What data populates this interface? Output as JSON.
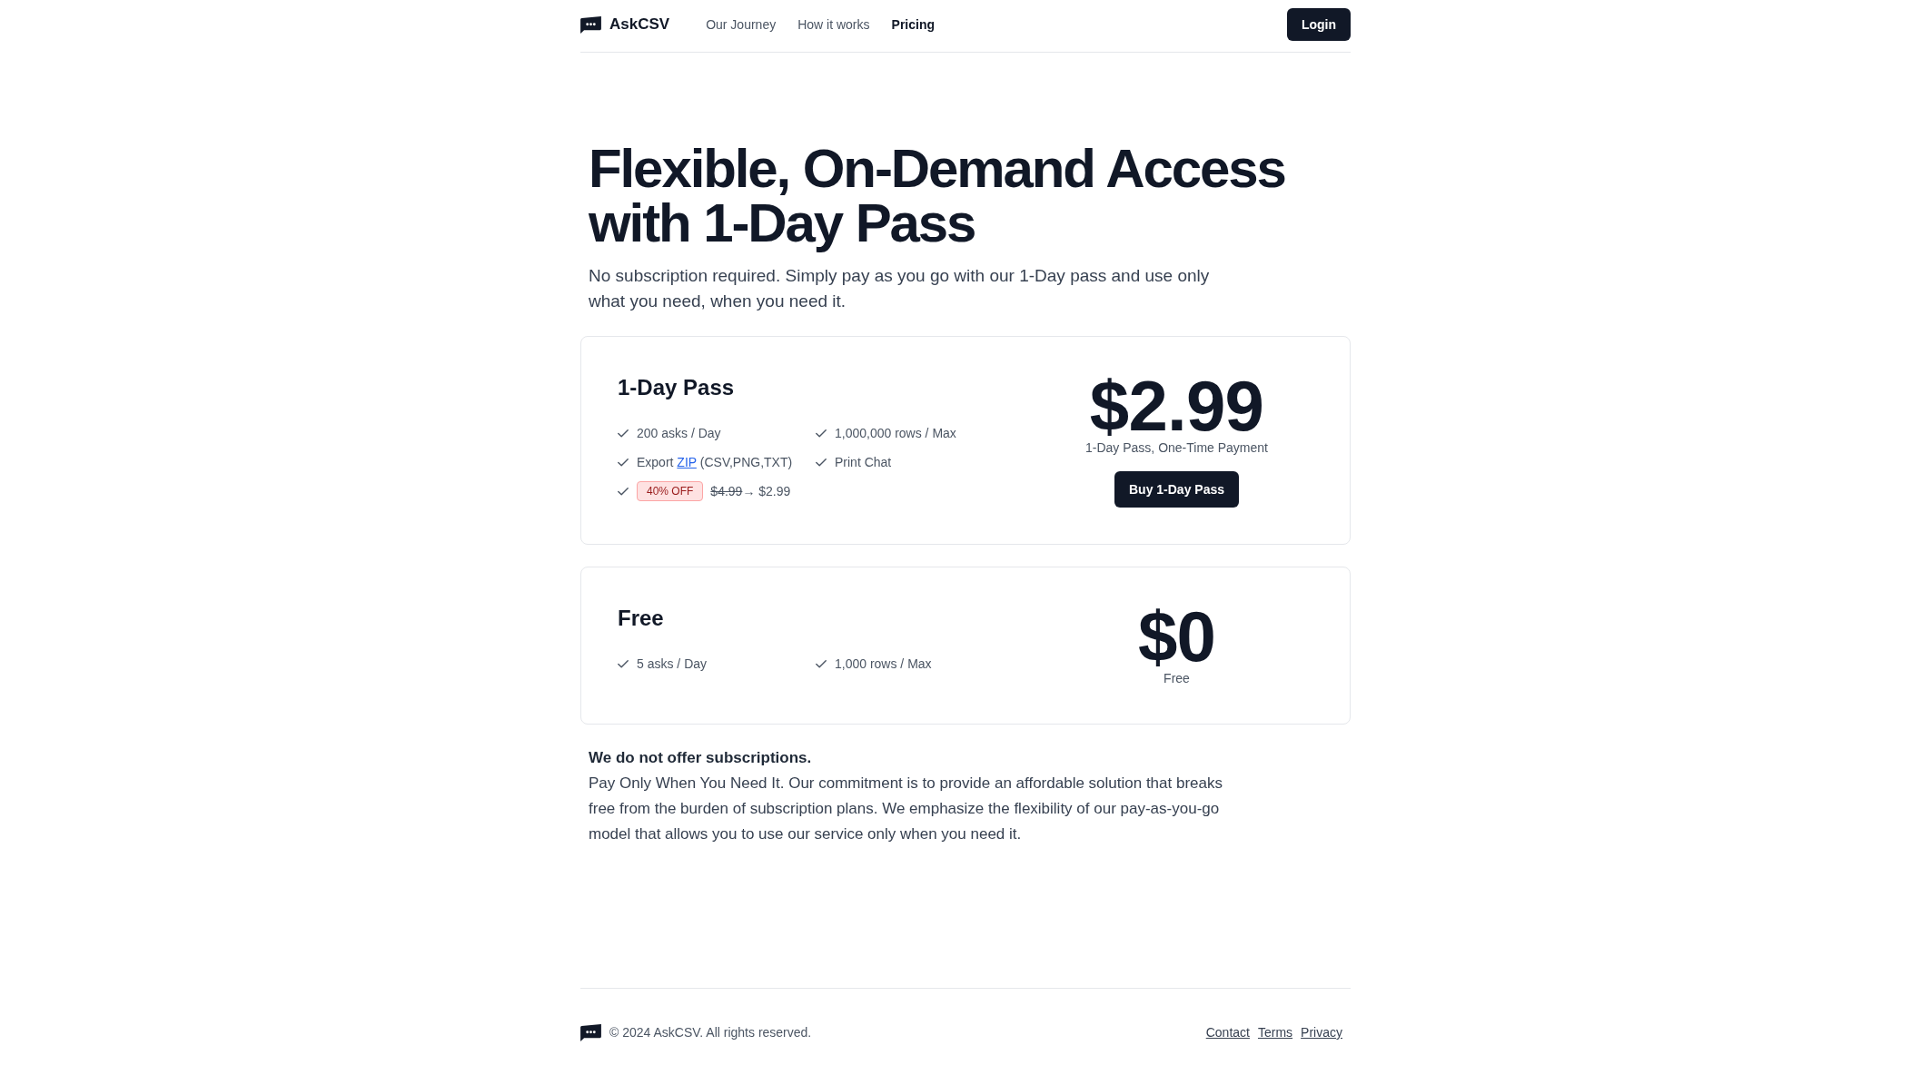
{
  "header": {
    "brand": "AskCSV",
    "nav": [
      {
        "label": "Our Journey",
        "selected": false
      },
      {
        "label": "How it works",
        "selected": false
      },
      {
        "label": "Pricing",
        "selected": true
      }
    ],
    "login_button": "Login"
  },
  "hero": {
    "title": "Flexible, On-Demand Access with 1-Day Pass",
    "subtitle": "No subscription required. Simply pay as you go with our 1-Day pass and use only what you need, when you need it."
  },
  "plans": [
    {
      "name": "1-Day Pass",
      "features": [
        {
          "kind": "text",
          "text": "200 asks / Day"
        },
        {
          "kind": "text",
          "text": "1,000,000 rows / Max"
        },
        {
          "kind": "link",
          "before": "Export",
          "link": "ZIP",
          "after": "(CSV,PNG,TXT)"
        },
        {
          "kind": "text",
          "text": "Print Chat"
        },
        {
          "kind": "discount",
          "badge": "40% OFF",
          "old_price": "$4.99",
          "new_price": "→ $2.99"
        }
      ],
      "price": "$2.99",
      "price_caption": "1-Day Pass, One-Time Payment",
      "button": "Buy 1-Day Pass"
    },
    {
      "name": "Free",
      "features": [
        {
          "kind": "text",
          "text": "5 asks / Day"
        },
        {
          "kind": "text",
          "text": "1,000 rows / Max"
        }
      ],
      "price": "$0",
      "price_caption": "Free"
    }
  ],
  "note": {
    "heading": "We do not offer subscriptions.",
    "body": "Pay Only When You Need It. Our commitment is to provide an affordable solution that breaks free from the burden of subscription plans. We emphasize the flexibility of our pay-as-you-go model that allows you to use our service only when you need it."
  },
  "footer": {
    "copyright": "© 2024 AskCSV. All rights reserved.",
    "links": [
      "Contact",
      "Terms",
      "Privacy"
    ]
  }
}
